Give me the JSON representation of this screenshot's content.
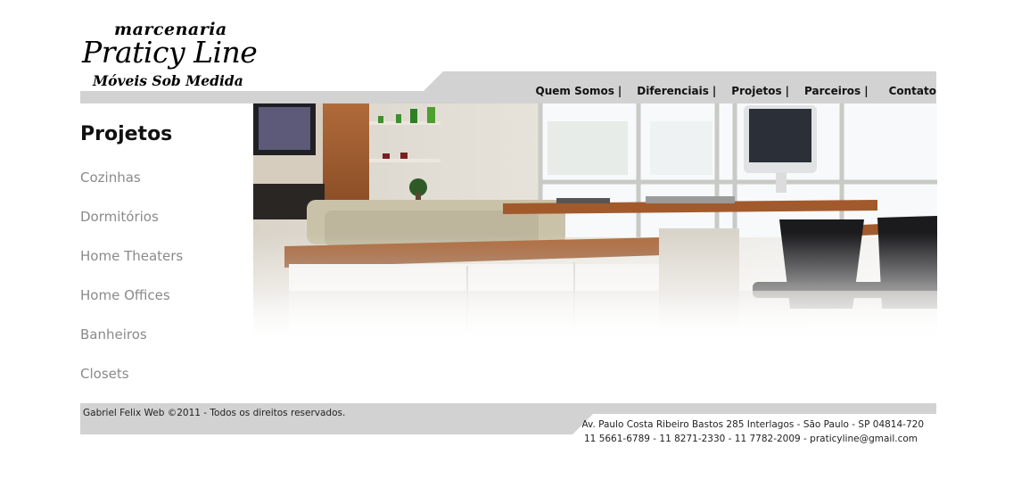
{
  "logo": {
    "line1": "marcenaria",
    "line2": "Praticy Line",
    "line3": "Móveis Sob Medida"
  },
  "nav": {
    "items": [
      "Quem Somos",
      "Diferenciais",
      "Projetos",
      "Parceiros",
      "Contato"
    ],
    "separator": "|"
  },
  "sidebar": {
    "title": "Projetos",
    "items": [
      "Cozinhas",
      "Dormitórios",
      "Home Theaters",
      "Home Offices",
      "Banheiros",
      "Closets"
    ]
  },
  "footer": {
    "copyright": "Gabriel Felix Web ©2011 - Todos os direitos reservados.",
    "address": "Av. Paulo Costa Ribeiro Bastos 285 Interlagos - São Paulo - SP 04814-720",
    "contacts": "11 5661-6789 - 11 8271-2330 - 11 7782-2009 - praticyline@gmail.com"
  },
  "colors": {
    "bar_gray": "#d2d2d2",
    "link_gray": "#8a8a8a"
  }
}
